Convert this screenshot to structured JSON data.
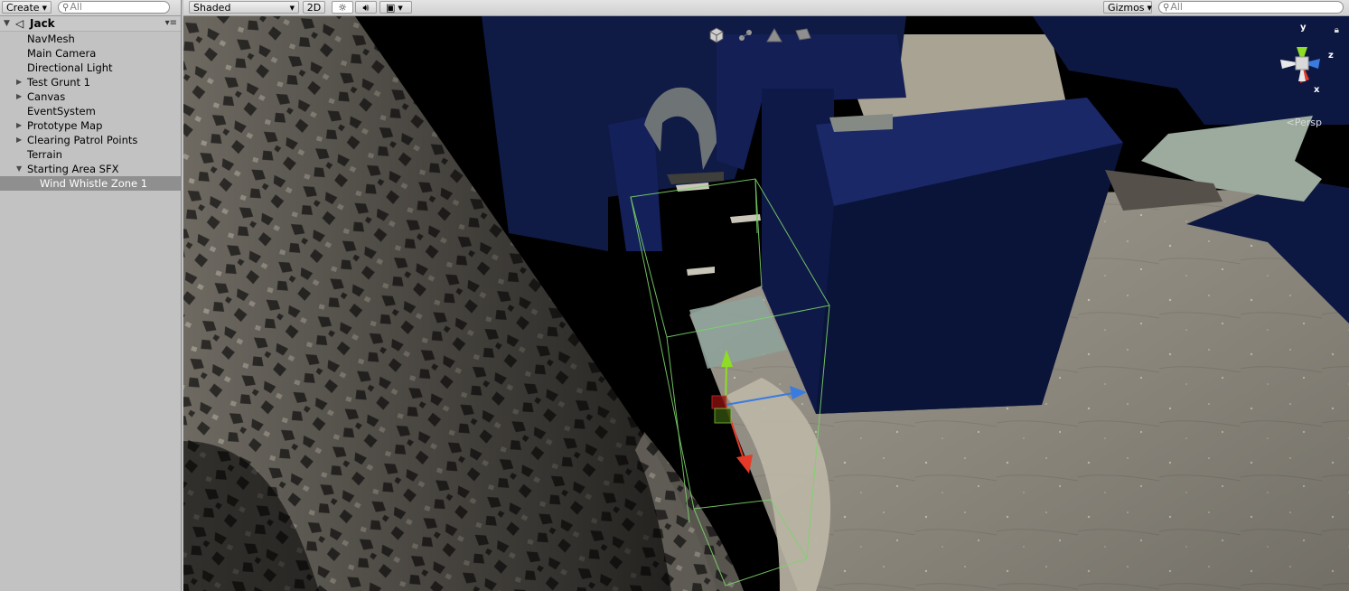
{
  "hierarchy": {
    "create_label": "Create",
    "search_placeholder": "All",
    "scene_name": "Jack",
    "items": [
      {
        "label": "NavMesh",
        "foldout": ""
      },
      {
        "label": "Main Camera",
        "foldout": ""
      },
      {
        "label": "Directional Light",
        "foldout": ""
      },
      {
        "label": "Test Grunt 1",
        "foldout": "▶"
      },
      {
        "label": "Canvas",
        "foldout": "▶"
      },
      {
        "label": "EventSystem",
        "foldout": ""
      },
      {
        "label": "Prototype Map",
        "foldout": "▶"
      },
      {
        "label": "Clearing Patrol Points",
        "foldout": "▶"
      },
      {
        "label": "Terrain",
        "foldout": ""
      },
      {
        "label": "Starting Area SFX",
        "foldout": "▼"
      },
      {
        "label": "Wind Whistle Zone 1",
        "foldout": "",
        "selected": true
      }
    ]
  },
  "scene_toolbar": {
    "draw_mode": "Shaded",
    "mode_2d": "2D",
    "gizmos_label": "Gizmos",
    "search_placeholder": "All"
  },
  "orientation_gizmo": {
    "projection": "Persp",
    "axes": {
      "y": "y",
      "z": "z",
      "x": "x"
    }
  },
  "icons": {
    "sun": "sun-icon",
    "audio": "audio-icon",
    "image": "image-effects-icon",
    "lock": "lock-icon"
  },
  "colors": {
    "selection": "#8f8f8f",
    "bounds": "#7cd46a",
    "axis_x": "#e53a28",
    "axis_y": "#8fdc24",
    "axis_z": "#3a7be0",
    "walls": "#101c4e"
  }
}
